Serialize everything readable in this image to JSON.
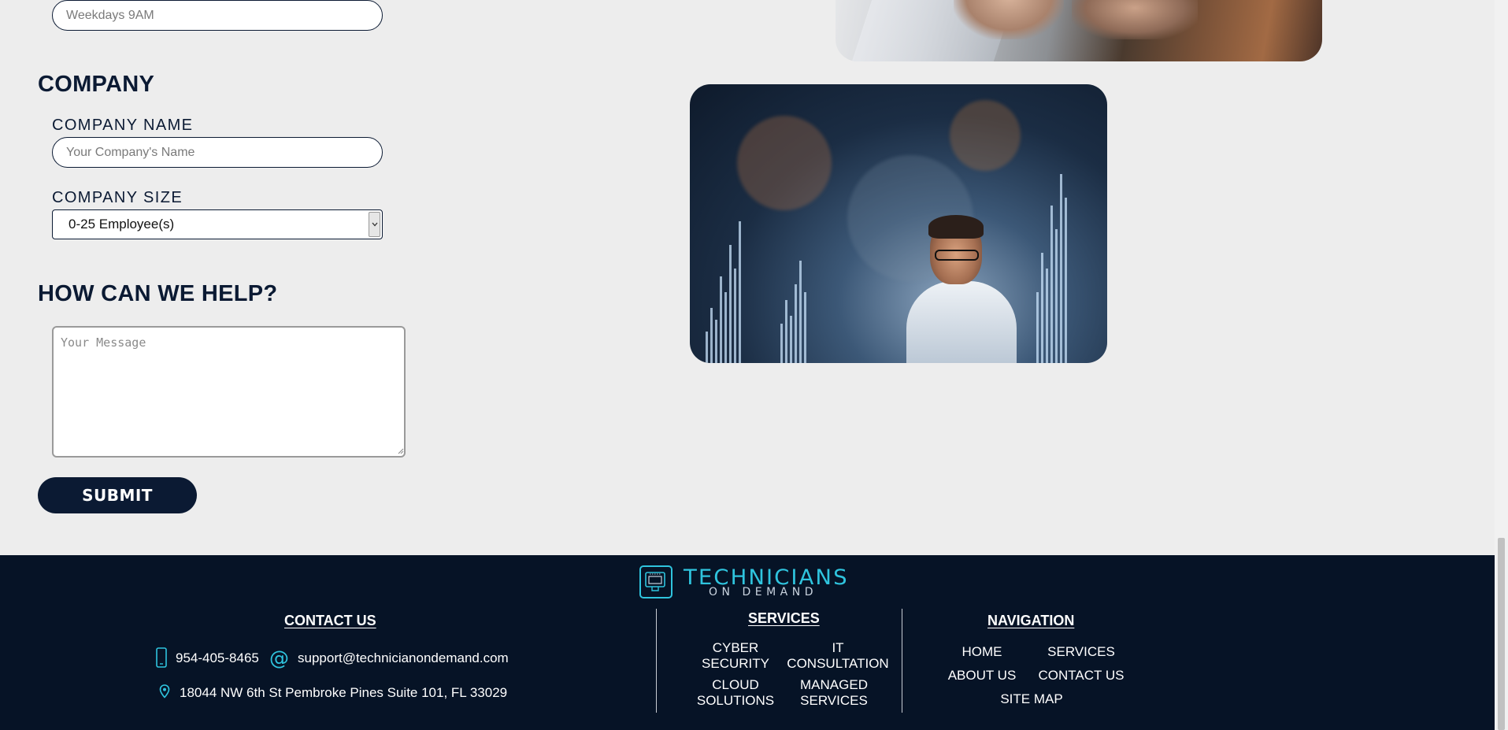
{
  "form": {
    "time_field": {
      "placeholder": "Weekdays 9AM"
    },
    "company_heading": "COMPANY",
    "company_name": {
      "label": "COMPANY NAME",
      "placeholder": "Your Company's Name"
    },
    "company_size": {
      "label": "COMPANY SIZE",
      "selected": "0-25 Employee(s)"
    },
    "help_heading": "HOW CAN WE HELP?",
    "message": {
      "placeholder": "Your Message"
    },
    "submit_label": "SUBMIT"
  },
  "footer": {
    "logo": {
      "main": "TECHNICIANS",
      "sub": "ON DEMAND"
    },
    "contact": {
      "heading": "CONTACT US",
      "phone": "954-405-8465",
      "email": "support@technicianondemand.com",
      "address": "18044 NW 6th St Pembroke Pines Suite 101, FL 33029",
      "icons": {
        "phone": "phone-icon",
        "email": "at-icon",
        "address": "map-pin-icon"
      }
    },
    "services": {
      "heading": "SERVICES",
      "items": [
        {
          "line1": "CYBER",
          "line2": "SECURITY"
        },
        {
          "line1": "IT",
          "line2": "CONSULTATION"
        },
        {
          "line1": "CLOUD",
          "line2": "SOLUTIONS"
        },
        {
          "line1": "MANAGED",
          "line2": "SERVICES"
        }
      ]
    },
    "navigation": {
      "heading": "NAVIGATION",
      "items": [
        "HOME",
        "SERVICES",
        "ABOUT US",
        "CONTACT US",
        "SITE MAP"
      ]
    }
  },
  "colors": {
    "navy": "#0b1a33",
    "footer_bg": "#061326",
    "accent": "#2fc4de",
    "page_bg": "#ededed"
  }
}
